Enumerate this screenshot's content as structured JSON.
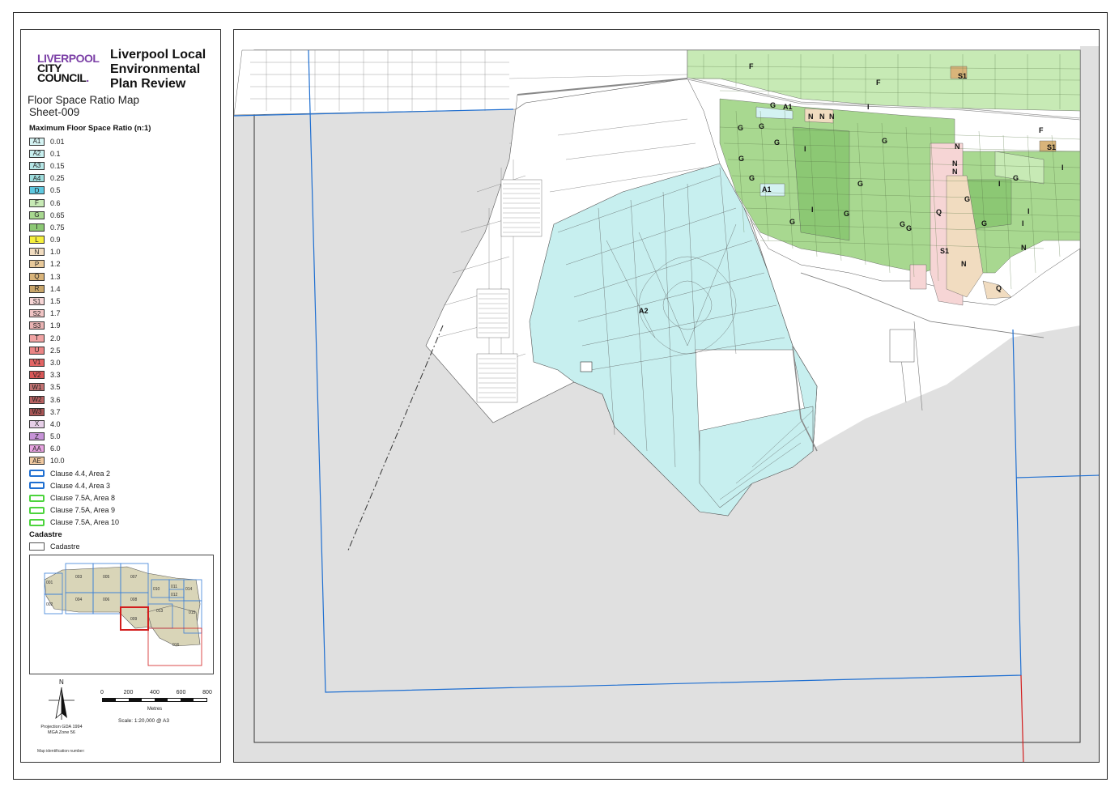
{
  "header": {
    "logo_line1": "LIVERPOOL",
    "logo_line2": "CITY",
    "logo_line3": "COUNCIL",
    "plan_title": "Liverpool Local Environmental Plan Review",
    "map_title": "Floor Space Ratio Map",
    "sheet": "Sheet-009"
  },
  "legend": {
    "heading": "Maximum Floor Space Ratio (n:1)",
    "items": [
      {
        "code": "A1",
        "value": "0.01",
        "color": "#d4f2f2"
      },
      {
        "code": "A2",
        "value": "0.1",
        "color": "#c7efef"
      },
      {
        "code": "A3",
        "value": "0.15",
        "color": "#b5e6e6"
      },
      {
        "code": "A4",
        "value": "0.25",
        "color": "#9fdede"
      },
      {
        "code": "D",
        "value": "0.5",
        "color": "#5ec8e0"
      },
      {
        "code": "F",
        "value": "0.6",
        "color": "#c7eab5"
      },
      {
        "code": "G",
        "value": "0.65",
        "color": "#a8d890"
      },
      {
        "code": "I",
        "value": "0.75",
        "color": "#8cc874"
      },
      {
        "code": "L",
        "value": "0.9",
        "color": "#f5ef3c"
      },
      {
        "code": "N",
        "value": "1.0",
        "color": "#f1dcc0"
      },
      {
        "code": "P",
        "value": "1.2",
        "color": "#e8c99a"
      },
      {
        "code": "Q",
        "value": "1.3",
        "color": "#d9b47a"
      },
      {
        "code": "R",
        "value": "1.4",
        "color": "#c9a66b"
      },
      {
        "code": "S1",
        "value": "1.5",
        "color": "#f6d5d5"
      },
      {
        "code": "S2",
        "value": "1.7",
        "color": "#f0c4c4"
      },
      {
        "code": "S3",
        "value": "1.9",
        "color": "#e9b3b3"
      },
      {
        "code": "T",
        "value": "2.0",
        "color": "#f0a3a3"
      },
      {
        "code": "U",
        "value": "2.5",
        "color": "#ea8585"
      },
      {
        "code": "V1",
        "value": "3.0",
        "color": "#e26464"
      },
      {
        "code": "V2",
        "value": "3.3",
        "color": "#d95757"
      },
      {
        "code": "W1",
        "value": "3.5",
        "color": "#c27272"
      },
      {
        "code": "W2",
        "value": "3.6",
        "color": "#b86262"
      },
      {
        "code": "W3",
        "value": "3.7",
        "color": "#a85555"
      },
      {
        "code": "X",
        "value": "4.0",
        "color": "#e6cfe8"
      },
      {
        "code": "Z",
        "value": "5.0",
        "color": "#c793d8"
      },
      {
        "code": "AA",
        "value": "6.0",
        "color": "#e7a3e0"
      },
      {
        "code": "AE",
        "value": "10.0",
        "color": "#f0c9a0"
      }
    ],
    "clauses": [
      {
        "label": "Clause 4.4, Area 2",
        "color": "#1f6fd1"
      },
      {
        "label": "Clause 4.4, Area 3",
        "color": "#1f6fd1"
      },
      {
        "label": "Clause 7.5A, Area 8",
        "color": "#4cd43c"
      },
      {
        "label": "Clause 7.5A, Area 9",
        "color": "#4cd43c"
      },
      {
        "label": "Clause 7.5A, Area 10",
        "color": "#4cd43c"
      }
    ],
    "cadastre_heading": "Cadastre",
    "cadastre_label": "Cadastre"
  },
  "index_map": {
    "sheets": [
      "001",
      "002",
      "003",
      "004",
      "005",
      "006",
      "007",
      "008",
      "009",
      "010",
      "011",
      "012",
      "013",
      "014",
      "015",
      "016"
    ]
  },
  "scale": {
    "labels": [
      "0",
      "200",
      "400",
      "600",
      "800"
    ],
    "units": "Metres",
    "text": "Scale: 1:20,000 @ A3"
  },
  "projection": {
    "line1": "Projection GDA 1994",
    "line2": "MGA Zone 56"
  },
  "north_label": "N",
  "map_id_label": "Map identification number:",
  "map_labels": [
    {
      "text": "A2"
    },
    {
      "text": "A1"
    },
    {
      "text": "A1"
    },
    {
      "text": "F"
    },
    {
      "text": "F"
    },
    {
      "text": "F"
    },
    {
      "text": "G"
    },
    {
      "text": "G"
    },
    {
      "text": "G"
    },
    {
      "text": "G"
    },
    {
      "text": "G"
    },
    {
      "text": "G"
    },
    {
      "text": "G"
    },
    {
      "text": "G"
    },
    {
      "text": "G"
    },
    {
      "text": "G"
    },
    {
      "text": "G"
    },
    {
      "text": "G"
    },
    {
      "text": "G"
    },
    {
      "text": "G"
    },
    {
      "text": "G"
    },
    {
      "text": "I"
    },
    {
      "text": "I"
    },
    {
      "text": "I"
    },
    {
      "text": "I"
    },
    {
      "text": "I"
    },
    {
      "text": "I"
    },
    {
      "text": "I"
    },
    {
      "text": "N"
    },
    {
      "text": "N"
    },
    {
      "text": "N"
    },
    {
      "text": "N"
    },
    {
      "text": "N"
    },
    {
      "text": "N"
    },
    {
      "text": "N"
    },
    {
      "text": "N"
    },
    {
      "text": "Q"
    },
    {
      "text": "Q"
    },
    {
      "text": "S1"
    },
    {
      "text": "S1"
    },
    {
      "text": "S1"
    }
  ],
  "colors": {
    "outside_area": "#e0e0e0",
    "area_2_outline": "#1f6fd1",
    "sheet_boundary": "#d21e1e"
  }
}
